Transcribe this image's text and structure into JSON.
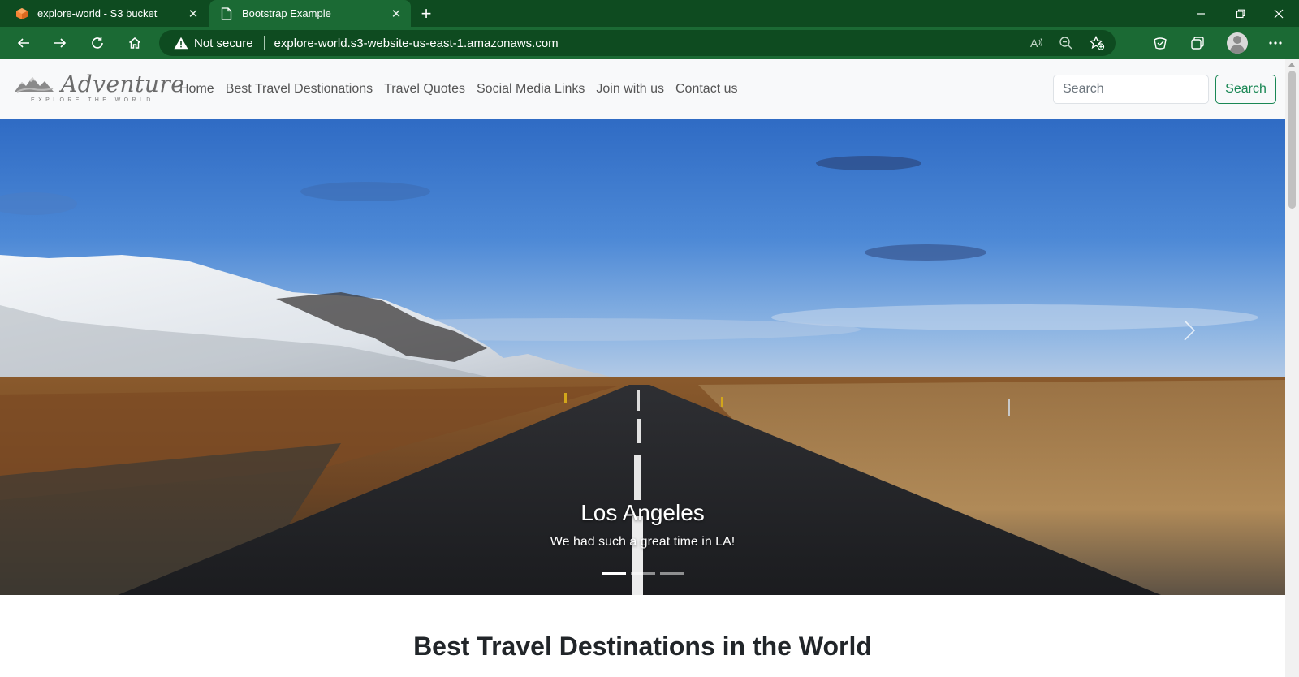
{
  "browser": {
    "tabs": [
      {
        "title": "explore-world - S3 bucket",
        "icon": "aws-box-icon",
        "active": false
      },
      {
        "title": "Bootstrap Example",
        "icon": "page-icon",
        "active": true
      }
    ],
    "security_label": "Not secure",
    "url": "explore-world.s3-website-us-east-1.amazonaws.com",
    "colors": {
      "frame": "#0e4b20",
      "toolbar": "#1b6a34"
    }
  },
  "navbar": {
    "brand": {
      "word": "Adventure",
      "tagline": "EXPLORE THE WORLD"
    },
    "links": [
      "Home",
      "Best Travel Destionations",
      "Travel Quotes",
      "Social Media Links",
      "Join with us",
      "Contact us"
    ],
    "search": {
      "placeholder": "Search",
      "button": "Search"
    },
    "colors": {
      "accent": "#198754",
      "background": "#f8f9fa"
    }
  },
  "carousel": {
    "caption_title": "Los Angeles",
    "caption_text": "We had such a great time in LA!",
    "slide_count": 3,
    "active_slide": 1
  },
  "section": {
    "title": "Best Travel Destinations in the World"
  }
}
